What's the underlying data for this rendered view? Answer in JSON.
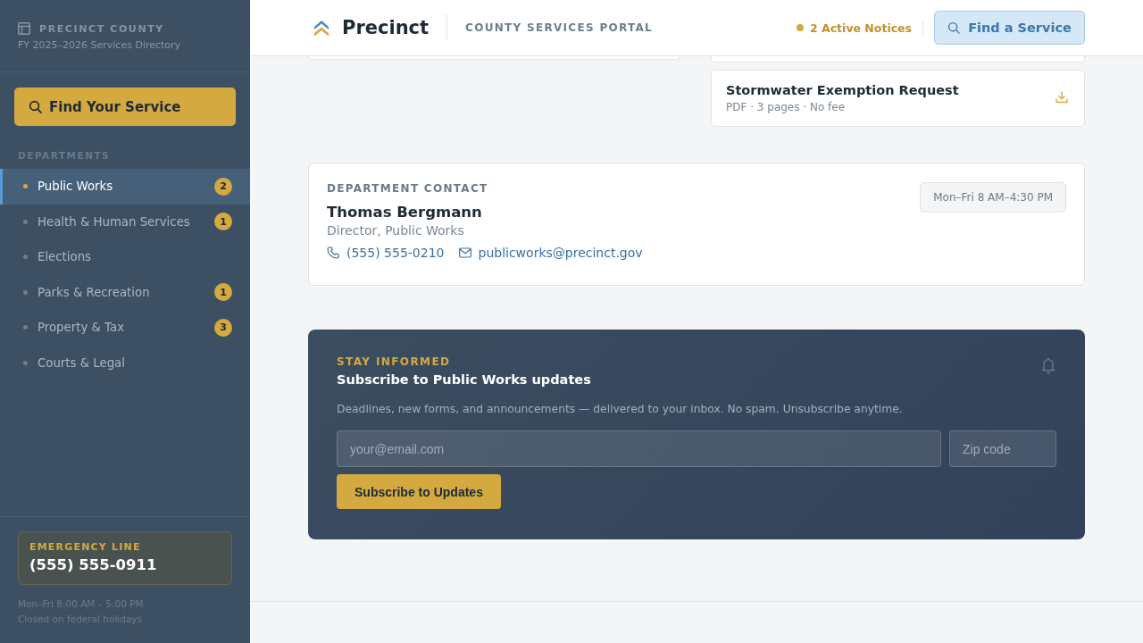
{
  "sidebar": {
    "brand": {
      "title": "PRECINCT COUNTY",
      "subtitle": "FY 2025–2026 Services Directory"
    },
    "search_button": "Find Your Service",
    "section_label": "DEPARTMENTS",
    "items": [
      {
        "label": "Public Works",
        "badge": "2",
        "selected": true
      },
      {
        "label": "Health & Human Services",
        "badge": "1",
        "selected": false
      },
      {
        "label": "Elections",
        "selected": false
      },
      {
        "label": "Parks & Recreation",
        "badge": "1",
        "selected": false
      },
      {
        "label": "Property & Tax",
        "badge": "3",
        "selected": false
      },
      {
        "label": "Courts & Legal",
        "selected": false
      }
    ],
    "emergency": {
      "label": "EMERGENCY LINE",
      "phone": "(555) 555-0911"
    },
    "hours": [
      "Mon–Fri 8:00 AM – 5:00 PM",
      "Closed on federal holidays"
    ]
  },
  "header": {
    "logo": "Precinct",
    "tagline": "COUNTY SERVICES PORTAL",
    "notices": "2 Active Notices",
    "button": "Find a Service"
  },
  "documents": [
    {
      "title": "Stormwater Exemption Request",
      "meta": "PDF · 3 pages · No fee"
    }
  ],
  "contact": {
    "label": "DEPARTMENT CONTACT",
    "name": "Thomas Bergmann",
    "role": "Director, Public Works",
    "phone": "(555) 555-0210",
    "email": "publicworks@precinct.gov",
    "hours": "Mon–Fri 8 AM–4:30 PM"
  },
  "subscribe": {
    "eyebrow": "STAY INFORMED",
    "title": "Subscribe to Public Works updates",
    "description": "Deadlines, new forms, and announcements — delivered to your inbox. No spam. Unsubscribe anytime.",
    "email_placeholder": "your@email.com",
    "zip_placeholder": "Zip code",
    "button": "Subscribe to Updates"
  }
}
